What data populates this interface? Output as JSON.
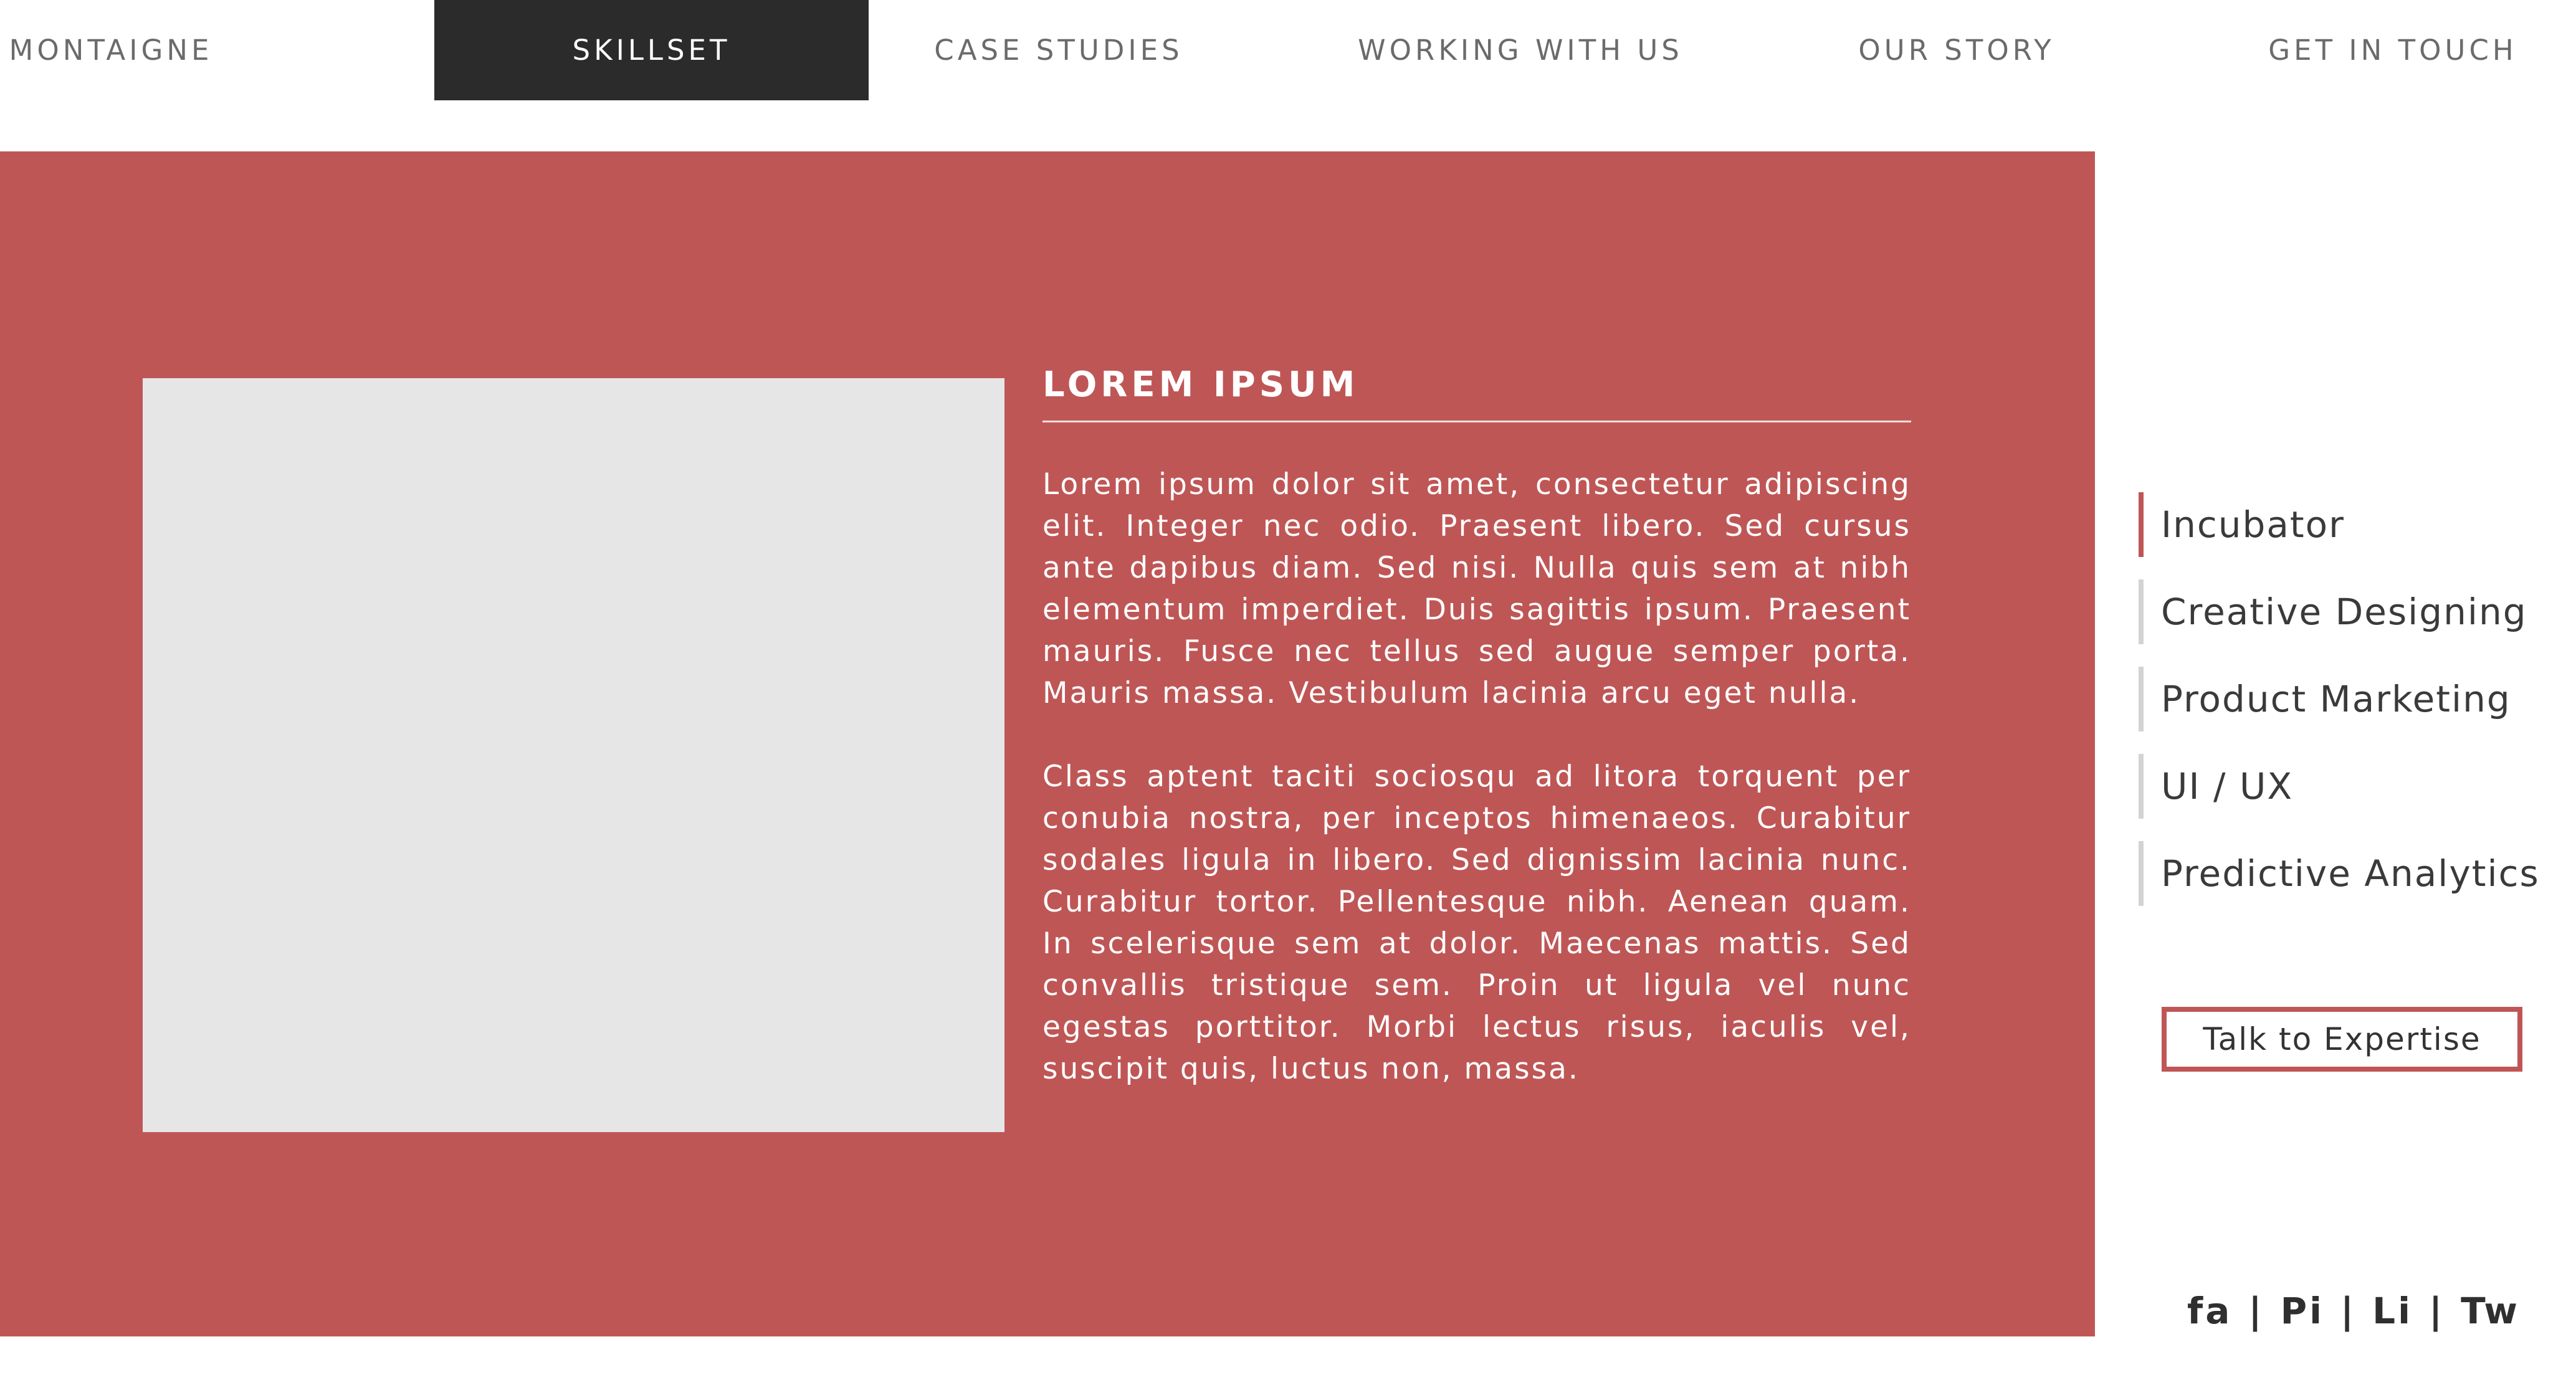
{
  "nav": {
    "items": [
      {
        "label": "MONTAIGNE"
      },
      {
        "label": "SKILLSET"
      },
      {
        "label": "CASE STUDIES"
      },
      {
        "label": "WORKING WITH US"
      },
      {
        "label": "OUR STORY"
      },
      {
        "label": "GET IN TOUCH"
      }
    ],
    "active": "SKILLSET"
  },
  "hero": {
    "title": "LOREM IPSUM",
    "paragraphs": [
      "Lorem ipsum dolor sit amet, consectetur adipiscing elit. Integer nec odio. Praesent libero. Sed cursus ante dapibus diam. Sed nisi. Nulla quis sem at nibh elementum imperdiet. Duis sagittis ipsum. Praesent mauris. Fusce nec tellus sed augue semper porta. Mauris massa. Vestibulum lacinia arcu eget nulla.",
      "Class aptent taciti sociosqu ad litora torquent per conubia nostra, per inceptos himenaeos. Curabitur sodales ligula in libero. Sed dignissim lacinia nunc. Curabitur tortor. Pellentesque nibh. Aenean quam. In scelerisque sem at dolor. Maecenas mattis. Sed convallis tristique sem. Proin ut ligula vel nunc egestas porttitor. Morbi lectus risus, iaculis vel, suscipit quis, luctus non, massa."
    ],
    "scroll_icon": "arrow-down-circle-icon"
  },
  "sidebar": {
    "items": [
      {
        "label": "Incubator",
        "active": true
      },
      {
        "label": "Creative Designing",
        "active": false
      },
      {
        "label": "Product Marketing",
        "active": false
      },
      {
        "label": "UI / UX",
        "active": false
      },
      {
        "label": "Predictive Analytics",
        "active": false
      }
    ],
    "cta_label": "Talk to Expertise"
  },
  "social": {
    "links": [
      "fa",
      "Pi",
      "Li",
      "Tw"
    ],
    "separator": "|"
  },
  "colors": {
    "accent": "#bf5656",
    "nav_active_bg": "#2b2b2b",
    "media_placeholder": "#e6e6e6"
  }
}
